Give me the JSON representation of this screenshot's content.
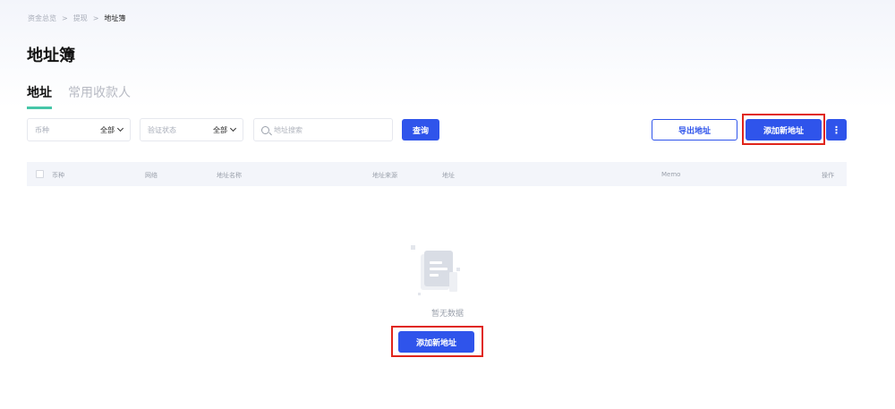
{
  "breadcrumb": {
    "items": [
      "资金总览",
      "提现",
      "地址簿"
    ]
  },
  "page": {
    "title": "地址簿"
  },
  "tabs": [
    {
      "label": "地址",
      "active": true
    },
    {
      "label": "常用收款人",
      "active": false
    }
  ],
  "filters": {
    "currency": {
      "label": "币种",
      "value": "全部"
    },
    "verify": {
      "label": "验证状态",
      "value": "全部"
    },
    "search_placeholder": "地址搜索",
    "query_label": "查询"
  },
  "actions": {
    "export_label": "导出地址",
    "add_label": "添加新地址",
    "more_label": "⋮"
  },
  "table": {
    "columns": [
      "币种",
      "网络",
      "地址名称",
      "地址来源",
      "地址",
      "Memo",
      "操作"
    ]
  },
  "empty": {
    "text": "暂无数据",
    "add_label": "添加新地址"
  },
  "colors": {
    "primary": "#2f54eb",
    "tab_accent": "#46c6a8",
    "highlight": "#e0251b"
  }
}
